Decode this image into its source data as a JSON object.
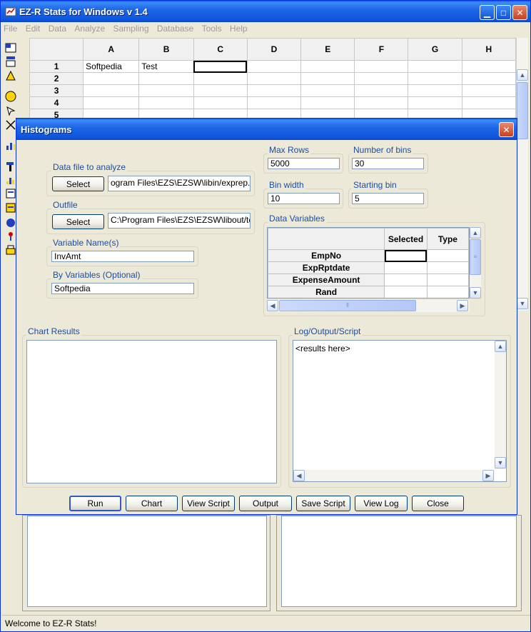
{
  "app": {
    "title": "EZ-R Stats for Windows v 1.4"
  },
  "menu": [
    "File",
    "Edit",
    "Data",
    "Analyze",
    "Sampling",
    "Database",
    "Tools",
    "Help"
  ],
  "grid": {
    "columns": [
      "A",
      "B",
      "C",
      "D",
      "E",
      "F",
      "G",
      "H"
    ],
    "rows": [
      {
        "num": "1",
        "cells": [
          "Softpedia",
          "Test",
          "",
          "",
          "",
          "",
          "",
          ""
        ]
      },
      {
        "num": "2",
        "cells": [
          "",
          "",
          "",
          "",
          "",
          "",
          "",
          ""
        ]
      },
      {
        "num": "3",
        "cells": [
          "",
          "",
          "",
          "",
          "",
          "",
          "",
          ""
        ]
      },
      {
        "num": "4",
        "cells": [
          "",
          "",
          "",
          "",
          "",
          "",
          "",
          ""
        ]
      },
      {
        "num": "5",
        "cells": [
          "",
          "",
          "",
          "",
          "",
          "",
          "",
          ""
        ]
      }
    ]
  },
  "status": "Welcome to EZ-R Stats!",
  "dialog": {
    "title": "Histograms",
    "data_file": {
      "label": "Data file to analyze",
      "button": "Select",
      "value": "ogram Files\\EZS\\EZSW\\libin/exprep.tab"
    },
    "outfile": {
      "label": "Outfile",
      "button": "Select",
      "value": "C:\\Program Files\\EZS\\EZSW\\libout/test"
    },
    "variable_names": {
      "label": "Variable Name(s)",
      "value": "InvAmt"
    },
    "by_variables": {
      "label": "By Variables (Optional)",
      "value": "Softpedia"
    },
    "max_rows": {
      "label": "Max Rows",
      "value": "5000"
    },
    "number_of_bins": {
      "label": "Number of bins",
      "value": "30"
    },
    "bin_width": {
      "label": "Bin width",
      "value": "10"
    },
    "starting_bin": {
      "label": "Starting bin",
      "value": "5"
    },
    "data_variables": {
      "label": "Data Variables",
      "headers": [
        "",
        "Selected",
        "Type"
      ],
      "rows": [
        "EmpNo",
        "ExpRptdate",
        "ExpenseAmount",
        "Rand"
      ]
    },
    "chart_results": {
      "label": "Chart Results"
    },
    "log": {
      "label": "Log/Output/Script",
      "text": "<results here>"
    },
    "buttons": {
      "run": "Run",
      "chart": "Chart",
      "view_script": "View Script",
      "output": "Output",
      "save_script": "Save Script",
      "view_log": "View Log",
      "close": "Close"
    }
  }
}
